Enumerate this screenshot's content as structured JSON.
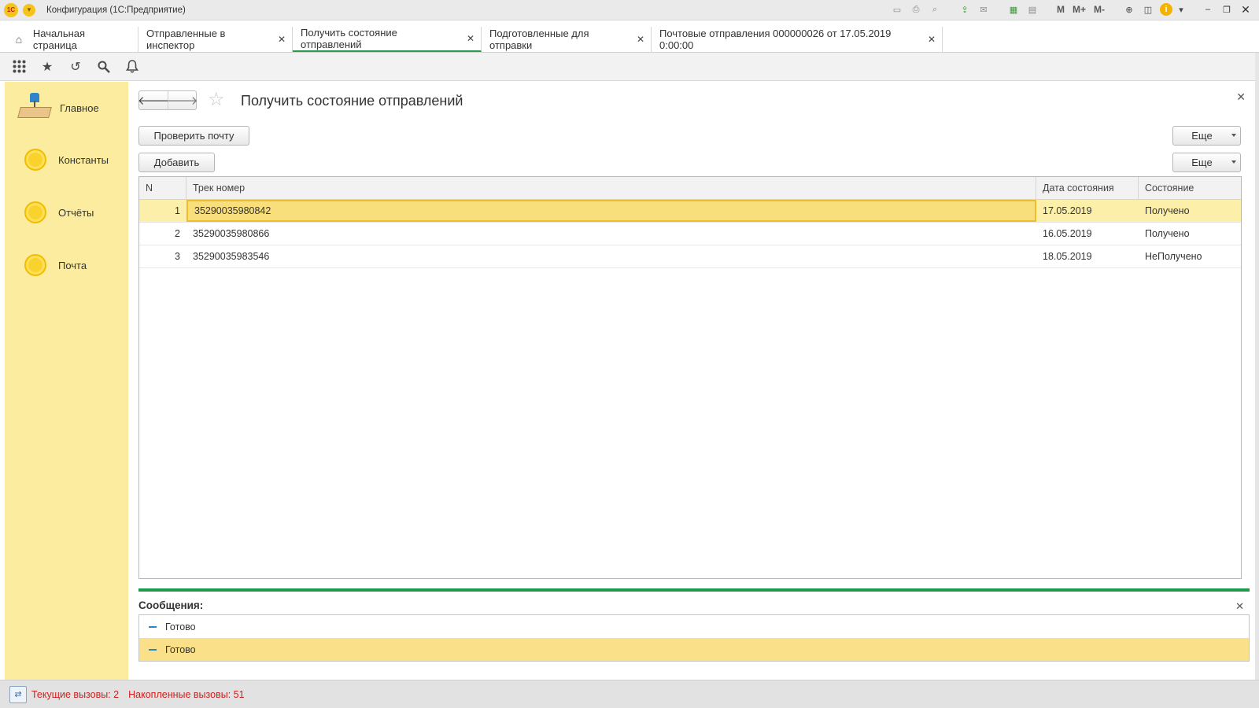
{
  "window": {
    "title": "Конфигурация  (1С:Предприятие)",
    "logo_text": "1С",
    "toolbar_text": {
      "m": "M",
      "m_plus": "M+",
      "m_minus": "M-"
    }
  },
  "tabs": [
    {
      "label": "Начальная страница",
      "closable": false
    },
    {
      "label": "Отправленные в инспектор",
      "closable": true
    },
    {
      "label": "Получить состояние отправлений",
      "closable": true,
      "active": true
    },
    {
      "label": "Подготовленные для отправки",
      "closable": true
    },
    {
      "label": "Почтовые отправления 000000026 от 17.05.2019 0:00:00",
      "closable": true
    }
  ],
  "sidebar": {
    "items": [
      {
        "label": "Главное",
        "icon": "desk-lamp-icon"
      },
      {
        "label": "Константы",
        "icon": "yellow-circle-icon"
      },
      {
        "label": "Отчёты",
        "icon": "yellow-circle-icon"
      },
      {
        "label": "Почта",
        "icon": "yellow-circle-icon"
      }
    ]
  },
  "form": {
    "title": "Получить состояние отправлений",
    "check_mail_button": "Проверить почту",
    "add_button": "Добавить",
    "more_button_1": "Еще",
    "more_button_2": "Еще"
  },
  "table": {
    "columns": [
      "N",
      "Трек номер",
      "Дата состояния",
      "Состояние"
    ],
    "rows": [
      {
        "n": "1",
        "track": "35290035980842",
        "date": "17.05.2019",
        "status": "Получено",
        "selected": true
      },
      {
        "n": "2",
        "track": "35290035980866",
        "date": "16.05.2019",
        "status": "Получено"
      },
      {
        "n": "3",
        "track": "35290035983546",
        "date": "18.05.2019",
        "status": "НеПолучено"
      }
    ]
  },
  "messages": {
    "title": "Сообщения:",
    "items": [
      "Готово",
      "Готово"
    ]
  },
  "status": {
    "current_calls": "Текущие вызовы: 2",
    "accumulated_calls": "Накопленные вызовы: 51"
  },
  "colors": {
    "sidebar_bg": "#fbec9f",
    "active_tab_underline": "#2d9b4e",
    "selection_bg": "#fcefaa",
    "status_text": "#d02020"
  }
}
